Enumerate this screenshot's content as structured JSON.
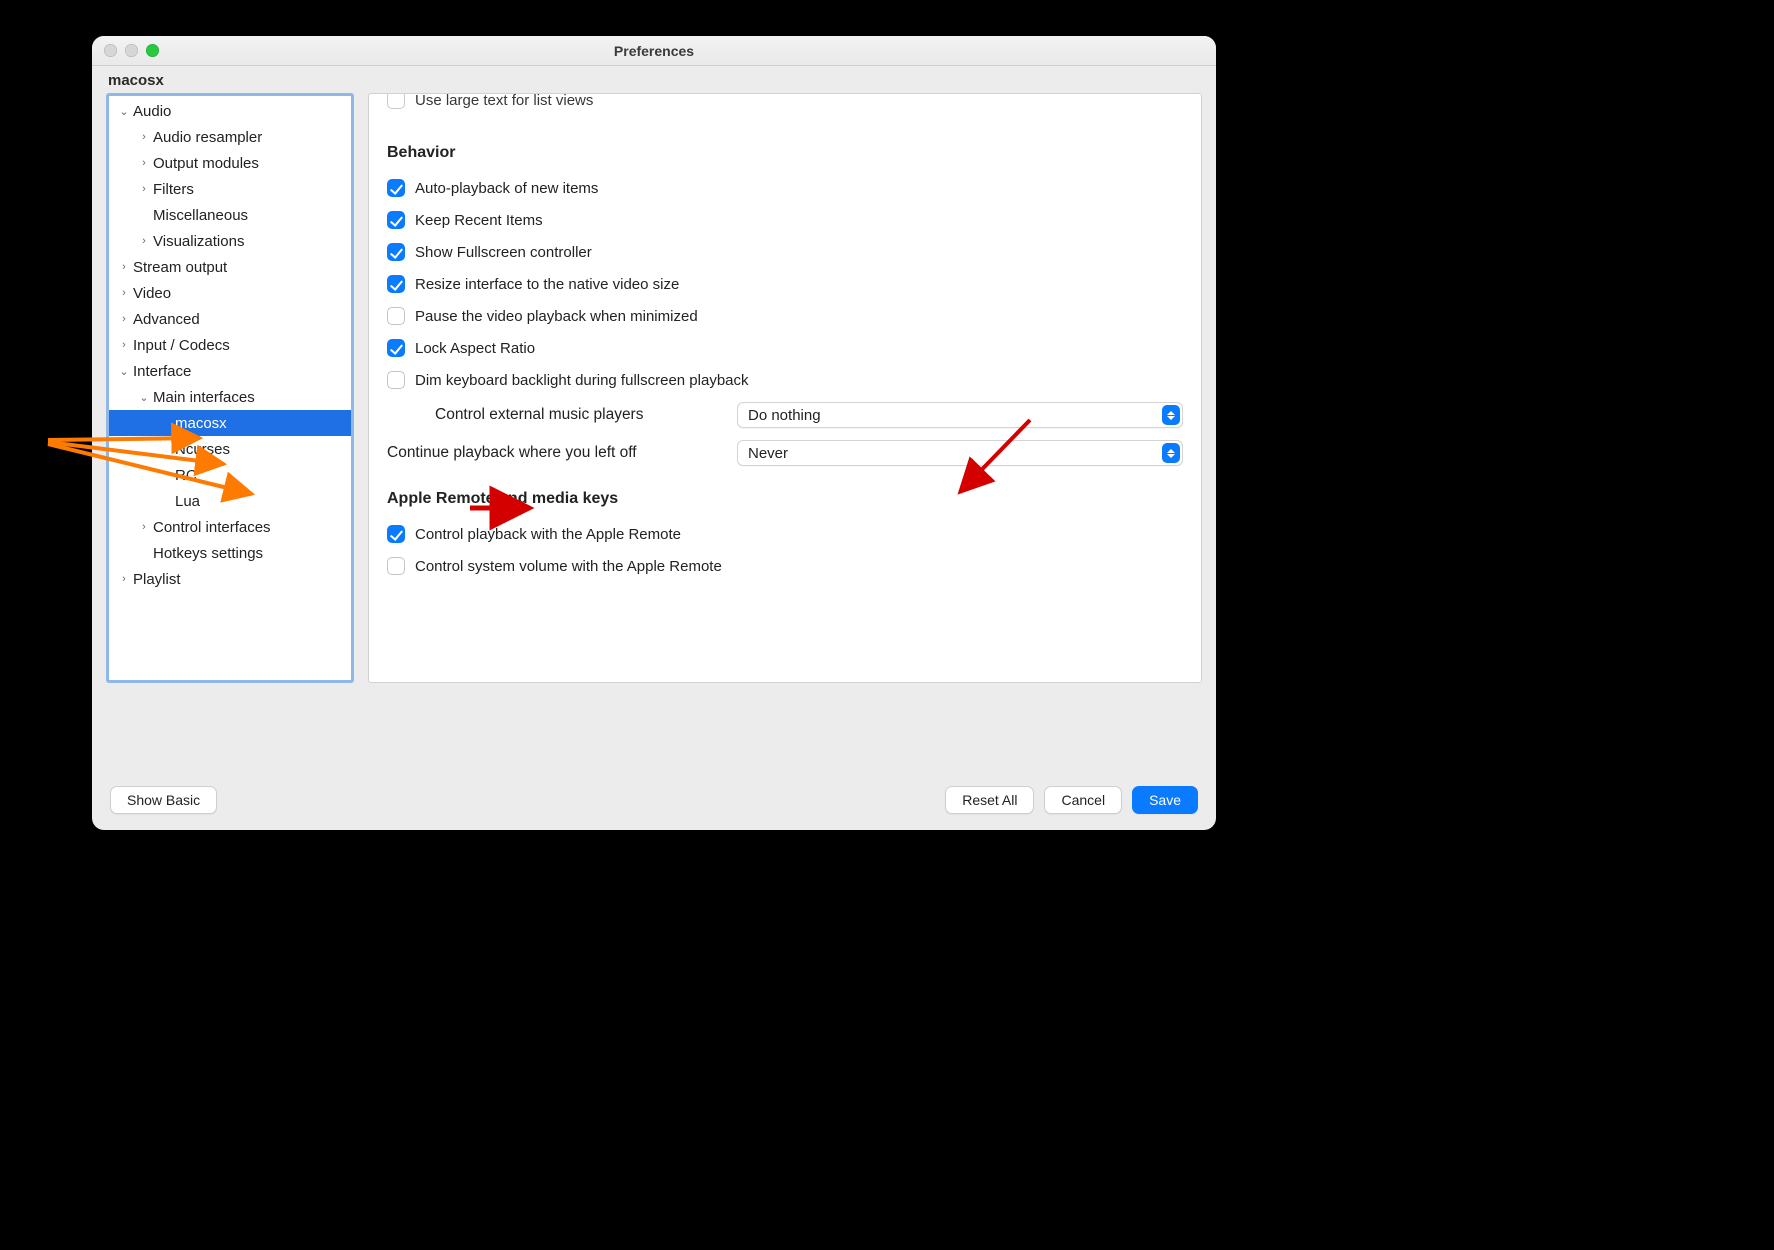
{
  "window": {
    "title": "Preferences"
  },
  "subheader": "macosx",
  "tree": {
    "audio": "Audio",
    "audio_resampler": "Audio resampler",
    "output_modules": "Output modules",
    "filters": "Filters",
    "miscellaneous": "Miscellaneous",
    "visualizations": "Visualizations",
    "stream_output": "Stream output",
    "video": "Video",
    "advanced": "Advanced",
    "input_codecs": "Input / Codecs",
    "interface": "Interface",
    "main_interfaces": "Main interfaces",
    "macosx": "macosx",
    "ncurses": "Ncurses",
    "rc": "RC",
    "lua": "Lua",
    "control_interfaces": "Control interfaces",
    "hotkeys_settings": "Hotkeys settings",
    "playlist": "Playlist"
  },
  "content": {
    "cutoff_row": "Use large text for list views",
    "section_behavior": "Behavior",
    "auto_playback": "Auto-playback of new items",
    "keep_recent": "Keep Recent Items",
    "show_fullscreen": "Show Fullscreen controller",
    "resize_interface": "Resize interface to the native video size",
    "pause_minimized": "Pause the video playback when minimized",
    "lock_aspect": "Lock Aspect Ratio",
    "dim_backlight": "Dim keyboard backlight during fullscreen playback",
    "control_external_label": "Control external music players",
    "control_external_value": "Do nothing",
    "continue_label": "Continue playback where you left off",
    "continue_value": "Never",
    "section_remote": "Apple Remote and media keys",
    "control_playback_remote": "Control playback with the Apple Remote",
    "control_volume_remote": "Control system volume with the Apple Remote"
  },
  "footer": {
    "show_basic": "Show Basic",
    "reset_all": "Reset All",
    "cancel": "Cancel",
    "save": "Save"
  },
  "colors": {
    "accent": "#0a7bff",
    "selection": "#1f6fe5",
    "annot_orange": "#ff7a00",
    "annot_red": "#d40000"
  }
}
